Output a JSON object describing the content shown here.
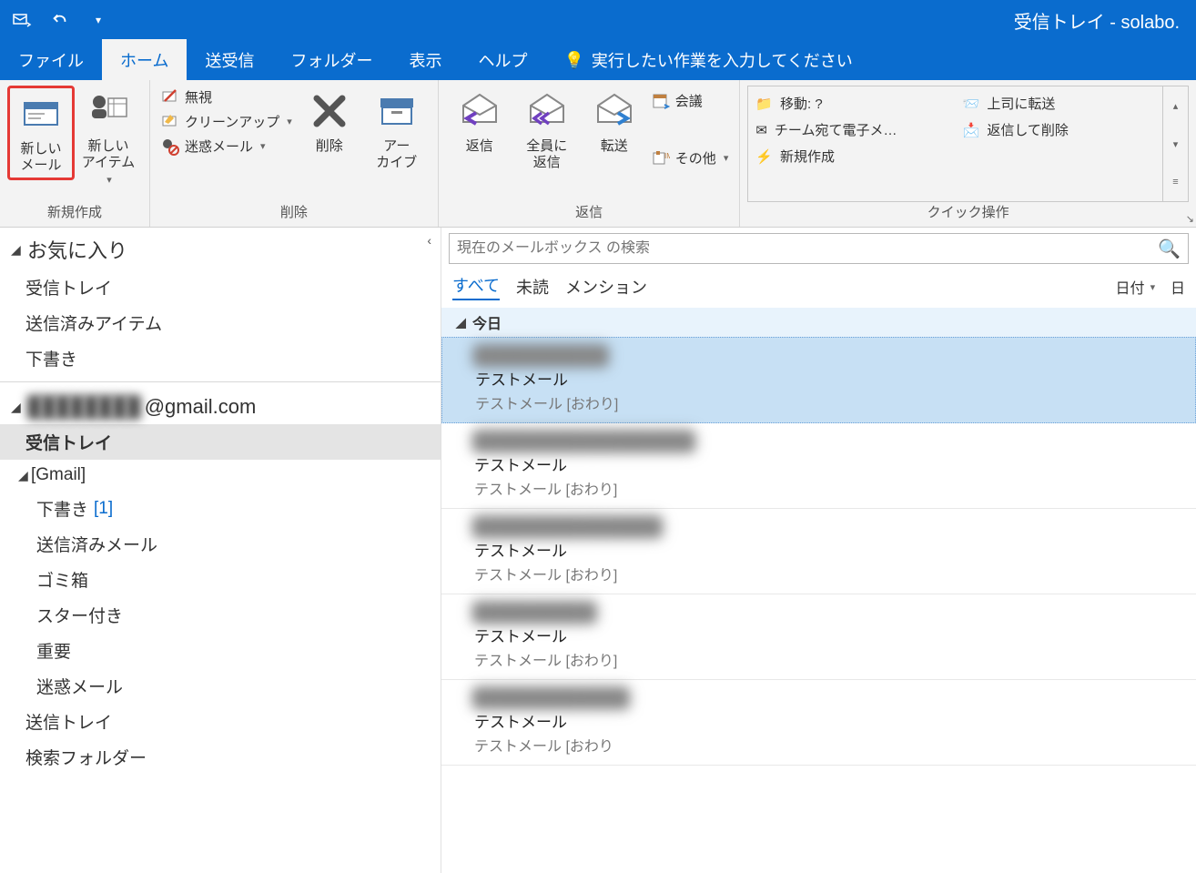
{
  "window_title": "受信トレイ - solabo.",
  "tabs": {
    "file": "ファイル",
    "home": "ホーム",
    "sendreceive": "送受信",
    "folder": "フォルダー",
    "view": "表示",
    "help": "ヘルプ",
    "tellme": "実行したい作業を入力してください"
  },
  "ribbon": {
    "new_group": "新規作成",
    "new_mail": "新しい\nメール",
    "new_items": "新しい\nアイテム",
    "delete_group": "削除",
    "ignore": "無視",
    "cleanup": "クリーンアップ",
    "junk": "迷惑メール",
    "delete": "削除",
    "archive": "アー\nカイブ",
    "respond_group": "返信",
    "reply": "返信",
    "reply_all": "全員に\n返信",
    "forward": "転送",
    "meeting": "会議",
    "more": "その他",
    "quicksteps_group": "クイック操作",
    "qs_move": "移動: ?",
    "qs_team": "チーム宛て電子メ…",
    "qs_new": "新規作成",
    "qs_boss": "上司に転送",
    "qs_replydel": "返信して削除"
  },
  "nav": {
    "favorites": "お気に入り",
    "inbox": "受信トレイ",
    "sent": "送信済みアイテム",
    "drafts": "下書き",
    "account_label": "@gmail.com",
    "account_blur": "████████",
    "inbox2": "受信トレイ",
    "gmail": "[Gmail]",
    "drafts2": "下書き",
    "drafts2_count": "[1]",
    "sent2": "送信済みメール",
    "trash": "ゴミ箱",
    "starred": "スター付き",
    "important": "重要",
    "junk": "迷惑メール",
    "outbox": "送信トレイ",
    "searchfolders": "検索フォルダー"
  },
  "search_placeholder": "現在のメールボックス の検索",
  "filters": {
    "all": "すべて",
    "unread": "未読",
    "mentions": "メンション",
    "sort_date": "日付",
    "sort_extra": "日"
  },
  "group_today": "今日",
  "messages": [
    {
      "from": "████████████",
      "subject": "テストメール",
      "preview": "テストメール [おわり]"
    },
    {
      "from": "████████████████████",
      "subject": "テストメール",
      "preview": "テストメール [おわり]"
    },
    {
      "from": "█████████████████",
      "subject": "テストメール",
      "preview": "テストメール [おわり]"
    },
    {
      "from": "███████████",
      "subject": "テストメール",
      "preview": "テストメール [おわり]"
    },
    {
      "from": "██████████████",
      "subject": "テストメール",
      "preview": "テストメール [おわり"
    }
  ]
}
